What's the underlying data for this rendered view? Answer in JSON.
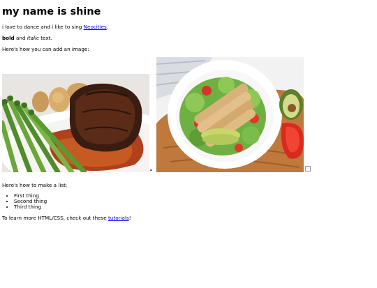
{
  "title": "my name is shine",
  "intro": {
    "text_before": "i love to dance and i like to sing ",
    "link_text": "Neocities",
    "text_after": "."
  },
  "formatting": {
    "bold": "bold",
    "mid": " and ",
    "italic": "italic",
    "after": " text."
  },
  "image_intro": "Here's how you can add an image:",
  "images": {
    "first_alt": "steak-photo",
    "second_alt": "salad-photo"
  },
  "list_intro": "Here's how to make a list:",
  "list_items": [
    "First thing",
    "Second thing",
    "Third thing"
  ],
  "outro": {
    "text_before": "To learn more HTML/CSS, check out these ",
    "link_text": "tutorials",
    "text_after": "!"
  },
  "colors": {
    "link": "#0000ee"
  }
}
